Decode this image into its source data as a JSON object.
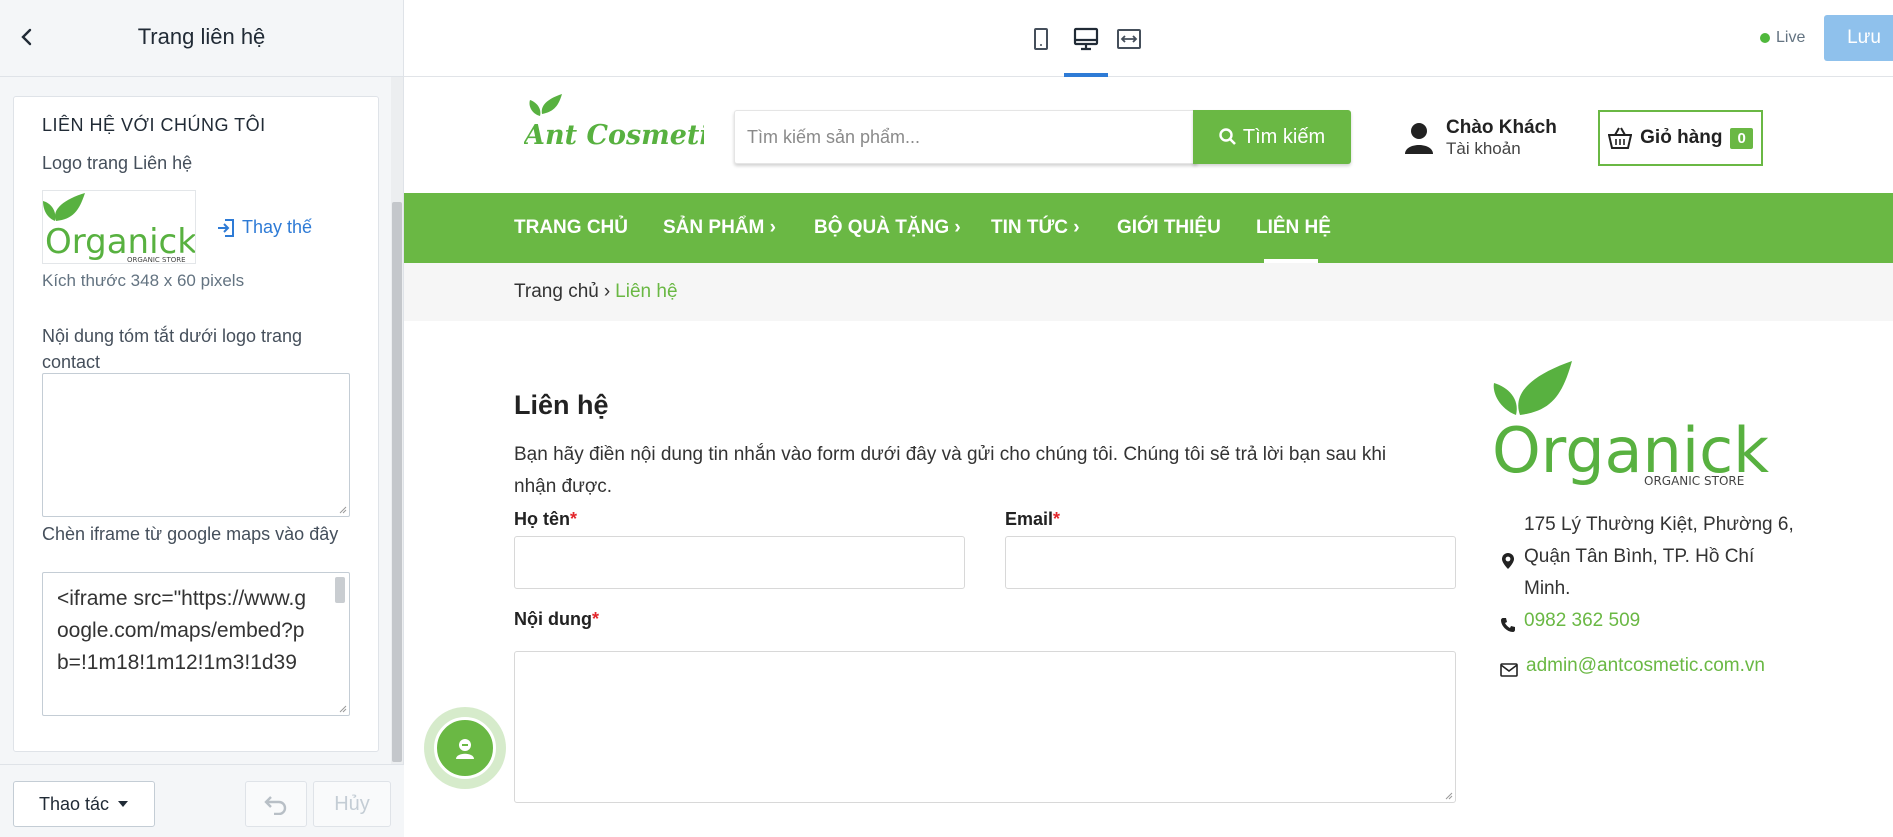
{
  "editor": {
    "title": "Trang liên hệ",
    "section_title": "LIÊN HỆ VỚI CHÚNG TÔI",
    "logo_label": "Logo trang Liên hệ",
    "replace_label": "Thay thế",
    "size_note": "Kích thước 348 x 60 pixels",
    "summary_label_line1": "Nội dung tóm tắt dưới logo trang",
    "summary_label_line2": "contact",
    "summary_value": "",
    "iframe_label": "Chèn iframe từ google maps vào đây",
    "iframe_value": "<iframe src=\"https://www.google.com/maps/embed?pb=!1m18!1m12!1m3!1d39",
    "logo_text": "Organick",
    "logo_sub": "ORGANIC STORE"
  },
  "footer": {
    "action_label": "Thao tác",
    "cancel_label": "Hủy"
  },
  "topbar": {
    "live_label": "Live",
    "save_label": "Lưu"
  },
  "site": {
    "brand": "Ant Cosmetic",
    "search_placeholder": "Tìm kiếm sản phẩm...",
    "search_button": "Tìm kiếm",
    "account_greeting": "Chào Khách",
    "account_sub": "Tài khoản",
    "cart_label": "Giỏ hàng",
    "cart_count": "0",
    "nav": [
      {
        "label": "TRANG CHỦ",
        "arrow": ""
      },
      {
        "label": "SẢN PHẨM",
        "arrow": "›"
      },
      {
        "label": "BỘ QUÀ TẶNG",
        "arrow": "›"
      },
      {
        "label": "TIN TỨC",
        "arrow": "›"
      },
      {
        "label": "GIỚI THIỆU",
        "arrow": ""
      },
      {
        "label": "LIÊN HỆ",
        "arrow": ""
      }
    ],
    "breadcrumb": {
      "home": "Trang chủ",
      "sep": "›",
      "current": "Liên hệ"
    },
    "heading": "Liên hệ",
    "description": "Bạn hãy điền nội dung tin nhắn vào form dưới đây và gửi cho chúng tôi. Chúng tôi sẽ trả lời bạn sau khi nhận được.",
    "form": {
      "name_label": "Họ tên",
      "email_label": "Email",
      "content_label": "Nội dung",
      "required_mark": "*"
    },
    "side_logo_text": "Organick",
    "side_logo_sub": "ORGANIC STORE",
    "address": "175 Lý Thường Kiệt, Phường 6, Quận Tân Bình, TP. Hồ Chí Minh.",
    "phone": "0982 362 509",
    "email": "admin@antcosmetic.com.vn"
  },
  "colors": {
    "brand_green": "#6ab844",
    "accent_blue": "#2e7bd6",
    "save_button": "#8fc1ec",
    "required": "#e3262b"
  },
  "icons": [
    "back-icon",
    "replace-icon",
    "caret-down-icon",
    "undo-icon",
    "mobile-icon",
    "desktop-icon",
    "fullwidth-icon",
    "search-icon",
    "user-icon",
    "basket-icon",
    "map-marker-icon",
    "phone-icon",
    "envelope-icon",
    "chat-icon"
  ]
}
